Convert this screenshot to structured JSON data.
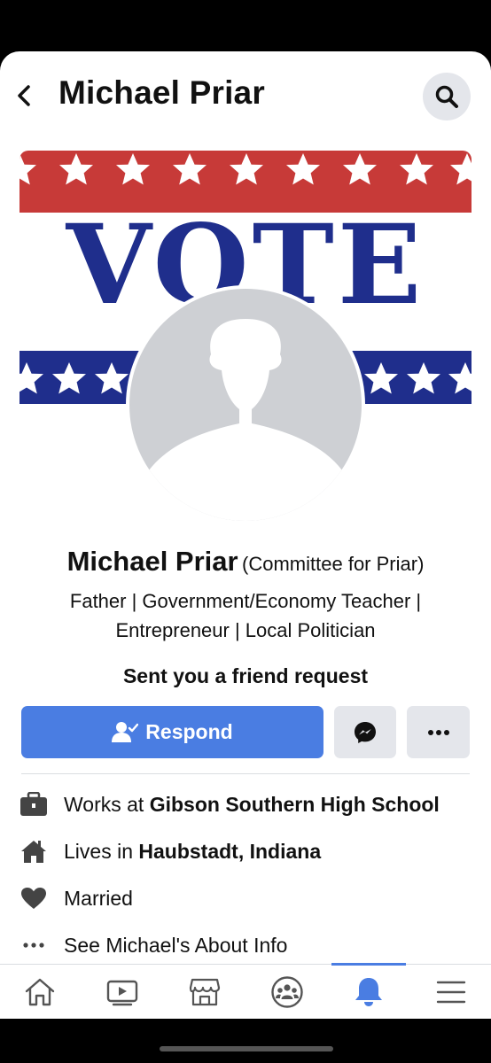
{
  "header": {
    "title": "Michael Priar",
    "back_icon": "chevron-left-icon",
    "search_icon": "search-icon"
  },
  "cover": {
    "banner_word": "VOTE",
    "colors": {
      "red": "#c73a38",
      "blue": "#1f2e8c"
    }
  },
  "profile": {
    "name": "Michael Priar",
    "page_label": "(Committee for Priar)",
    "bio_line1": "Father | Government/Economy Teacher |",
    "bio_line2": "Entrepreneur | Local Politician",
    "friend_request_text": "Sent you a friend request"
  },
  "actions": {
    "respond_label": "Respond",
    "respond_icon": "person-check-icon",
    "messenger_icon": "messenger-icon",
    "more_icon": "more-horizontal-icon",
    "accent_color": "#4a7de2"
  },
  "info": {
    "work_prefix": "Works at ",
    "work_place": "Gibson Southern High School",
    "home_prefix": "Lives in ",
    "home_place": "Haubstadt, Indiana",
    "relationship": "Married",
    "about_link": "See Michael's About Info"
  },
  "nav": {
    "items": [
      "home-icon",
      "video-icon",
      "marketplace-icon",
      "groups-icon",
      "notifications-icon",
      "menu-icon"
    ],
    "active": "notifications-icon"
  }
}
